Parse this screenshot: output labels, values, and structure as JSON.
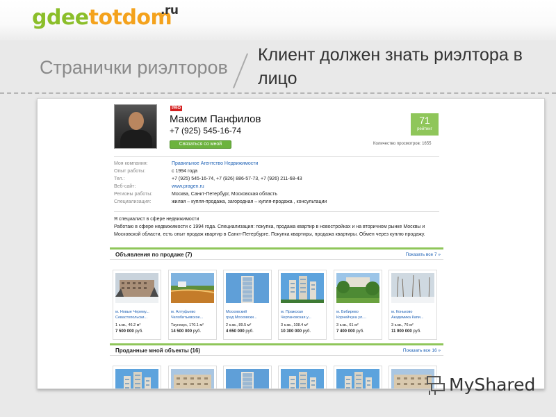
{
  "logo": {
    "part1": "gdee",
    "part2": "totdom",
    "tld": ".ru"
  },
  "slide": {
    "section_title": "Странички риэлторов",
    "headline": "Клиент должен знать риэлтора в лицо"
  },
  "agent": {
    "badge": "PRO",
    "name": "Максим Панфилов",
    "phone": "+7 (925) 545-16-74",
    "contact_button": "Связаться со мной",
    "rating": "71",
    "rating_label": "рейтинг",
    "views": "Количество просмотров: 1655"
  },
  "info": [
    {
      "label": "Моя компания:",
      "value": "Правильное Агентство Недвижимости",
      "link": true
    },
    {
      "label": "Опыт работы:",
      "value": "с 1994 года",
      "link": false
    },
    {
      "label": "Тел.:",
      "value": "+7 (925) 545-16-74, +7 (926) 886-57-73, +7 (926) 211-68-43",
      "link": false
    },
    {
      "label": "Веб-сайт:",
      "value": "www.pragen.ru",
      "link": true
    },
    {
      "label": "Регионы работы:",
      "value": "Москва, Санкт-Петербург, Московская область",
      "link": false
    },
    {
      "label": "Специализация:",
      "value": "жилая – купля-продажа, загородная – купля-продажа , консультации",
      "link": false
    }
  ],
  "about": {
    "line1": "Я специалист в сфере недвижимости",
    "line2": "Работаю в сфере недвижимости с 1994 года. Специализация: покупка, продажа квартир в новостройках и на вторичном рынке Москвы и Московской области, есть опыт продаж квартир в Санкт-Петербурге. Покупка квартиры, продажа квартиры. Обмен через куплю продажу."
  },
  "for_sale": {
    "title": "Объявления по продаже (7)",
    "show_all": "Показать все 7 »",
    "items": [
      {
        "loc1": "м. Новые Черему...",
        "loc2": "Севастопольски...",
        "area": "1 к.кв., 46.2 м²",
        "price": "7 500 000",
        "currency": "руб.",
        "scene": "winter-building"
      },
      {
        "loc1": "м. Алтуфьево",
        "loc2": "Челобитьевское...",
        "area": "Таунхаус, 170.1 м²",
        "price": "14 500 000",
        "currency": "руб.",
        "scene": "lake"
      },
      {
        "loc1": "Московский",
        "loc2": "град Московски...",
        "area": "2 к.кв., 89.5 м²",
        "price": "4 650 000",
        "currency": "руб.",
        "scene": "tower-blue"
      },
      {
        "loc1": "м. Пражская",
        "loc2": "Чертановская у...",
        "area": "3 к.кв., 108.4 м²",
        "price": "10 300 000",
        "currency": "руб.",
        "scene": "towers-sky"
      },
      {
        "loc1": "м. Бибирево",
        "loc2": "Корнейчука ул....",
        "area": "3 к.кв., 61 м²",
        "price": "7 400 000",
        "currency": "руб.",
        "scene": "park"
      },
      {
        "loc1": "м. Коньково",
        "loc2": "Академика Капи...",
        "area": "3 к.кв., 76 м²",
        "price": "11 900 000",
        "currency": "руб.",
        "scene": "winter-trees"
      }
    ]
  },
  "sold": {
    "title": "Проданные мной объекты (16)",
    "show_all": "Показать все 16 »",
    "items": [
      {
        "scene": "towers-sky"
      },
      {
        "scene": "beige-block"
      },
      {
        "scene": "tower-blue"
      },
      {
        "scene": "towers-sky"
      },
      {
        "scene": "towers-sky"
      },
      {
        "scene": "beige-block"
      }
    ]
  },
  "watermark": "MyShared",
  "colors": {
    "brand_green": "#8bbe2a",
    "brand_orange": "#f4a21c",
    "accent": "#8fc65a",
    "link": "#1b5fb4",
    "pro_red": "#d41f1f"
  }
}
